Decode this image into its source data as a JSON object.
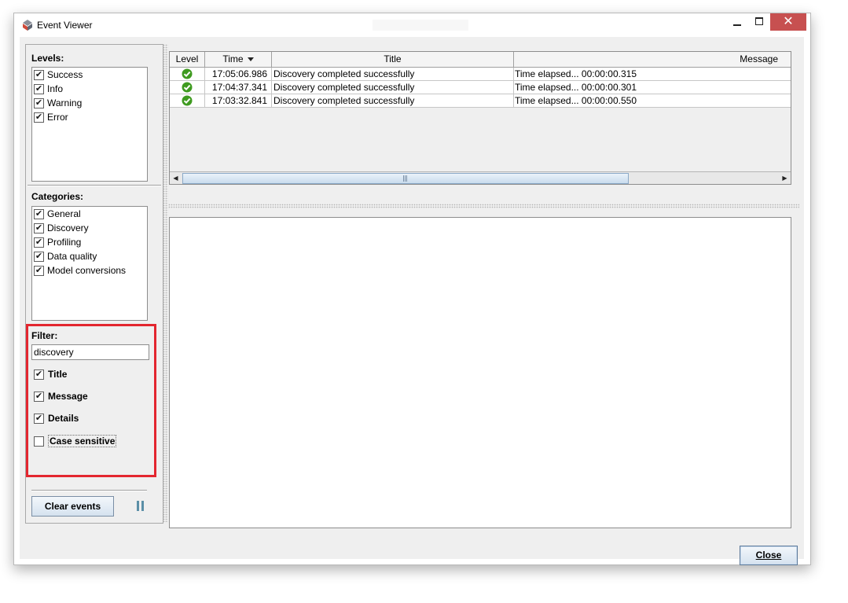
{
  "window": {
    "title": "Event Viewer",
    "close_glyph": "✕"
  },
  "levels": {
    "label": "Levels:",
    "items": [
      {
        "label": "Success",
        "checked": true
      },
      {
        "label": "Info",
        "checked": true
      },
      {
        "label": "Warning",
        "checked": true
      },
      {
        "label": "Error",
        "checked": true
      }
    ]
  },
  "categories": {
    "label": "Categories:",
    "items": [
      {
        "label": "General",
        "checked": true
      },
      {
        "label": "Discovery",
        "checked": true
      },
      {
        "label": "Profiling",
        "checked": true
      },
      {
        "label": "Data quality",
        "checked": true
      },
      {
        "label": "Model conversions",
        "checked": true
      }
    ]
  },
  "filter": {
    "label": "Filter:",
    "value": "discovery",
    "options": [
      {
        "label": "Title",
        "checked": true
      },
      {
        "label": "Message",
        "checked": true
      },
      {
        "label": "Details",
        "checked": true
      },
      {
        "label": "Case sensitive",
        "checked": false
      }
    ]
  },
  "buttons": {
    "clear_events": "Clear events",
    "close": "Close"
  },
  "table": {
    "columns": {
      "level": "Level",
      "time": "Time",
      "title": "Title",
      "message": "Message"
    },
    "rows": [
      {
        "level_icon": "success-check-icon",
        "time": "17:05:06.986",
        "title": "Discovery completed successfully",
        "message": "Time elapsed... 00:00:00.315"
      },
      {
        "level_icon": "success-check-icon",
        "time": "17:04:37.341",
        "title": "Discovery completed successfully",
        "message": "Time elapsed... 00:00:00.301"
      },
      {
        "level_icon": "success-check-icon",
        "time": "17:03:32.841",
        "title": "Discovery completed successfully",
        "message": "Time elapsed... 00:00:00.550"
      }
    ]
  },
  "colors": {
    "highlight": "#e3262f",
    "success": "#3e9a1f",
    "close_button_bg": "#c75050"
  },
  "icons": {
    "app": "app-logo-icon",
    "pause": "pause-icon",
    "sort": "sort-descending-icon"
  }
}
